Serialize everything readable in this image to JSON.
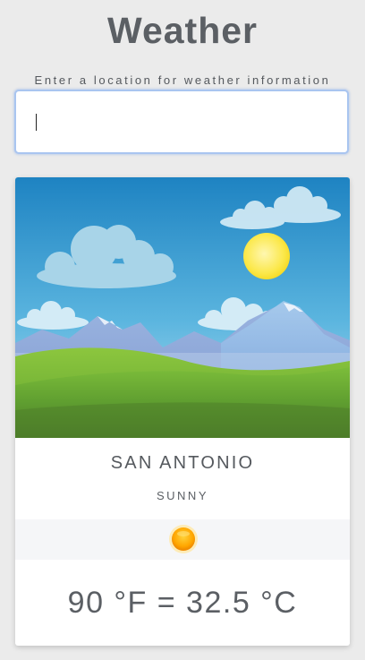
{
  "app": {
    "title": "Weather"
  },
  "search": {
    "label": "Enter a location for weather information",
    "value": "",
    "placeholder": ""
  },
  "weather_card": {
    "city": "SAN ANTONIO",
    "condition": "SUNNY",
    "condition_icon": "sun-icon",
    "temperature": "90 °F = 32.5 °C"
  },
  "colors": {
    "background": "#ebebeb",
    "text": "#5b5f64",
    "input_focus_border": "#a9c5f0",
    "card_background": "#ffffff",
    "icon_strip": "#f5f6f8",
    "sun": "#ffb000"
  }
}
